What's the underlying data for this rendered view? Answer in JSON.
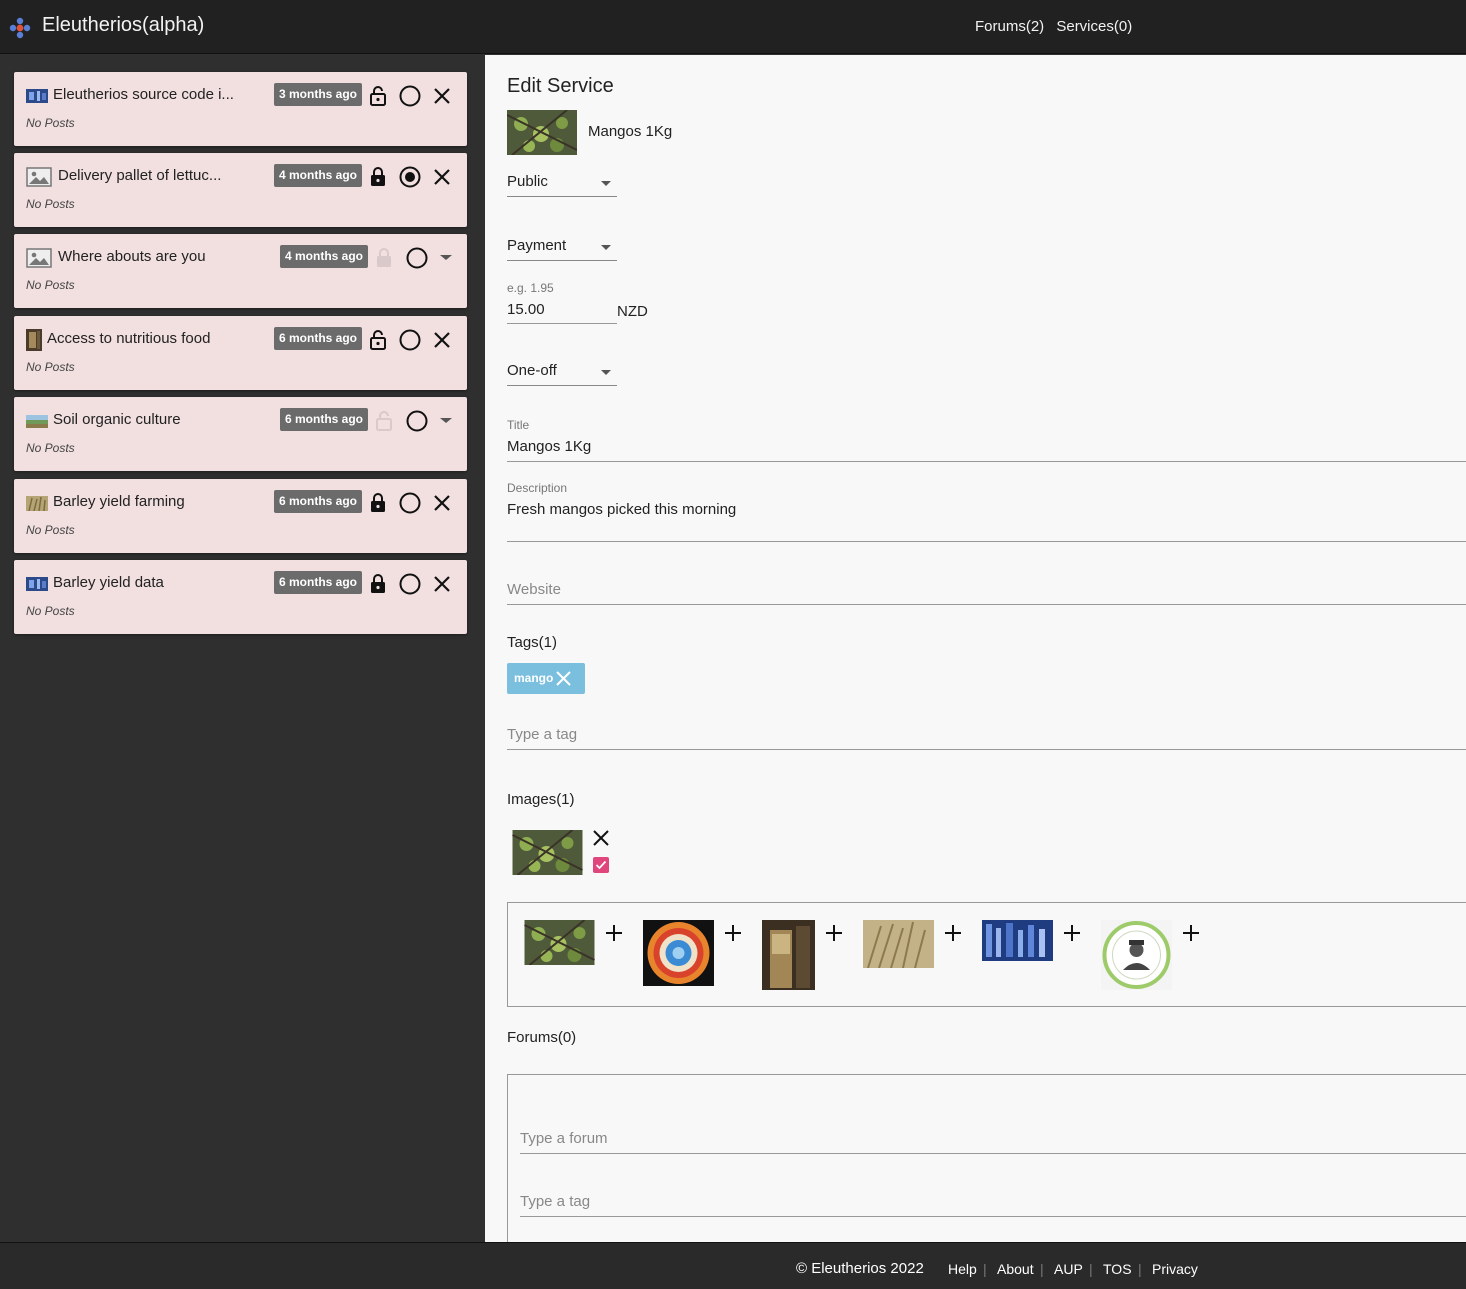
{
  "app": {
    "title": "Eleutherios(alpha)"
  },
  "topnav": {
    "forums": "Forums(2)",
    "services": "Services(0)"
  },
  "sidebar": {
    "cards": [
      {
        "title": "Eleutherios source code i...",
        "time": "3 months ago",
        "posts": "No Posts",
        "thumb": "blue-image-icon",
        "lock": "unlocked",
        "state": "circle",
        "action": "close"
      },
      {
        "title": "Delivery pallet of lettuc...",
        "time": "4 months ago",
        "posts": "No Posts",
        "thumb": "image-placeholder-icon",
        "lock": "locked",
        "state": "radio-checked",
        "action": "close"
      },
      {
        "title": "Where abouts are you",
        "time": "4 months ago",
        "posts": "No Posts",
        "thumb": "image-placeholder-icon",
        "lock": "disabled",
        "state": "circle",
        "action": "dropdown"
      },
      {
        "title": "Access to nutritious food",
        "time": "6 months ago",
        "posts": "No Posts",
        "thumb": "door-image-icon",
        "lock": "unlocked",
        "state": "circle",
        "action": "close"
      },
      {
        "title": "Soil organic culture",
        "time": "6 months ago",
        "posts": "No Posts",
        "thumb": "landscape-image-icon",
        "lock": "disabled",
        "state": "circle",
        "action": "dropdown"
      },
      {
        "title": "Barley yield farming",
        "time": "6 months ago",
        "posts": "No Posts",
        "thumb": "barley-image-icon",
        "lock": "locked",
        "state": "circle",
        "action": "close"
      },
      {
        "title": "Barley yield data",
        "time": "6 months ago",
        "posts": "No Posts",
        "thumb": "blue-image-icon",
        "lock": "locked",
        "state": "circle",
        "action": "close"
      }
    ]
  },
  "main": {
    "heading": "Edit Service",
    "service_name": "Mangos 1Kg",
    "visibility": "Public",
    "payment": "Payment",
    "amount_hint": "e.g. 1.95",
    "amount": "15.00",
    "currency": "NZD",
    "frequency": "One-off",
    "title_label": "Title",
    "title_value": "Mangos 1Kg",
    "description_label": "Description",
    "description_value": "Fresh mangos picked this morning",
    "website_placeholder": "Website",
    "tags_heading": "Tags(1)",
    "tag": "mango",
    "tag_placeholder": "Type a tag",
    "images_heading": "Images(1)",
    "gallery": [
      "mango-image-icon",
      "target-image-icon",
      "doorway-image-icon",
      "wheat-image-icon",
      "blue-pattern-image-icon",
      "hire-my-farmer-image-icon"
    ],
    "forums_heading": "Forums(0)",
    "forum_placeholder": "Type a forum",
    "forum_tag_placeholder": "Type a tag"
  },
  "footer": {
    "copyright": "© Eleutherios 2022",
    "links": [
      "Help",
      "About",
      "AUP",
      "TOS",
      "Privacy"
    ]
  }
}
